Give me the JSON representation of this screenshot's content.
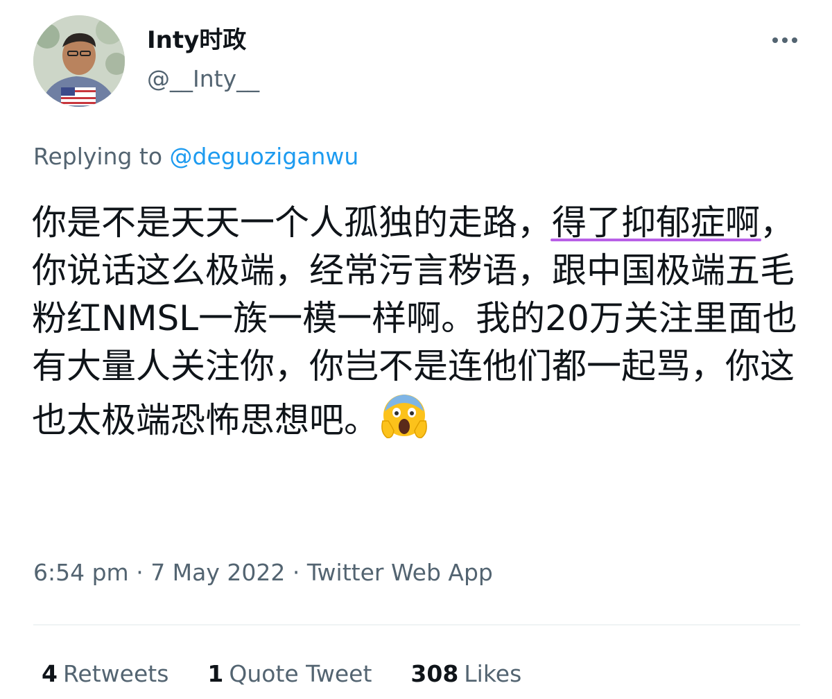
{
  "author": {
    "display_name": "Inty时政",
    "handle": "@__Inty__"
  },
  "reply": {
    "prefix": "Replying to ",
    "mention": "@deguoziganwu"
  },
  "tweet": {
    "segment_1": "你是不是天天一个人孤独的走路，",
    "highlight_1": "得了",
    "highlight_2": "抑郁症啊",
    "segment_2": "，你说话这么极端，经常污言秽语，跟中国极端五毛粉红NMSL一族一模一样啊。我的20万关注里面也有大量人关注你，你岂不是连他们都一起骂，你这也太极端恐怖思想吧。",
    "emoji": "face-screaming-in-fear",
    "highlight_color": "#b85fe6"
  },
  "meta": {
    "time": "6:54 pm",
    "sep1": " · ",
    "date": "7 May 2022",
    "sep2": " · ",
    "source": "Twitter Web App"
  },
  "stats": {
    "retweets_count": "4",
    "retweets_label": "Retweets",
    "quotes_count": "1",
    "quotes_label": "Quote Tweet",
    "likes_count": "308",
    "likes_label": "Likes"
  },
  "colors": {
    "primary_text": "#0f1419",
    "secondary_text": "#536471",
    "link": "#1d9bf0"
  }
}
